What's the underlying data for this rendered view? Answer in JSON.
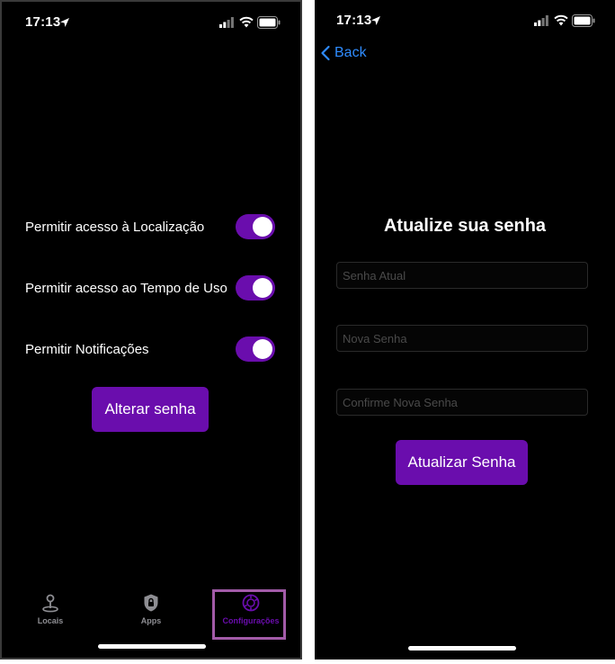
{
  "colors": {
    "accent": "#6a0dad",
    "link": "#2f8cff",
    "highlight": "#a25ba8",
    "background": "#000000"
  },
  "left_screen": {
    "status_bar": {
      "time": "17:13",
      "icons": [
        "location-arrow-icon",
        "signal-icon",
        "wifi-icon",
        "battery-icon"
      ]
    },
    "toggles": [
      {
        "label": "Permitir acesso à Localização",
        "on": true
      },
      {
        "label": "Permitir acesso ao Tempo de Uso",
        "on": true
      },
      {
        "label": "Permitir Notificações",
        "on": true
      }
    ],
    "change_password_button": "Alterar senha",
    "tabbar": {
      "tabs": [
        {
          "label": "Locais",
          "icon": "map-pin-icon",
          "active": false
        },
        {
          "label": "Apps",
          "icon": "shield-icon",
          "active": false
        },
        {
          "label": "Configurações",
          "icon": "settings-gear-icon",
          "active": true
        }
      ]
    }
  },
  "right_screen": {
    "status_bar": {
      "time": "17:13"
    },
    "back_label": "Back",
    "title": "Atualize sua senha",
    "fields": {
      "current_password_placeholder": "Senha Atual",
      "new_password_placeholder": "Nova Senha",
      "confirm_password_placeholder": "Confirme Nova Senha"
    },
    "submit_button": "Atualizar Senha"
  }
}
